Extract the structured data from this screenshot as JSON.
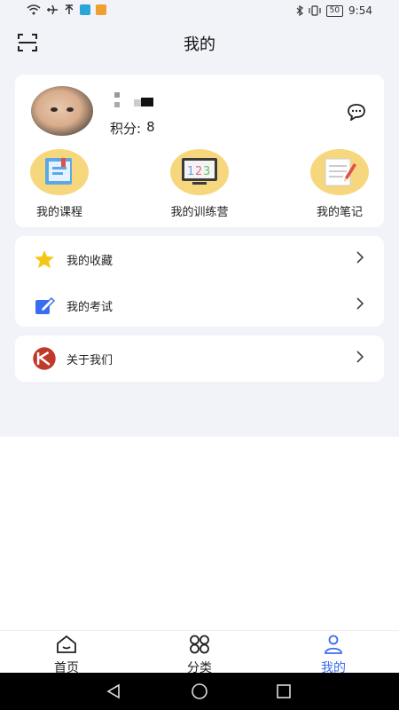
{
  "status_bar": {
    "time": "9:54",
    "battery": "50"
  },
  "header": {
    "title": "我的"
  },
  "profile": {
    "score_label": "积分:",
    "score_value": "8"
  },
  "entries": [
    {
      "label": "我的课程"
    },
    {
      "label": "我的训练营"
    },
    {
      "label": "我的笔记"
    }
  ],
  "menu": [
    {
      "label": "我的收藏"
    },
    {
      "label": "我的考试"
    }
  ],
  "about": {
    "label": "关于我们"
  },
  "tabs": [
    {
      "label": "首页"
    },
    {
      "label": "分类"
    },
    {
      "label": "我的"
    }
  ],
  "colors": {
    "accent": "#3a6df0",
    "entry_bg": "#f7d77e",
    "page_bg": "#f1f3f8"
  }
}
